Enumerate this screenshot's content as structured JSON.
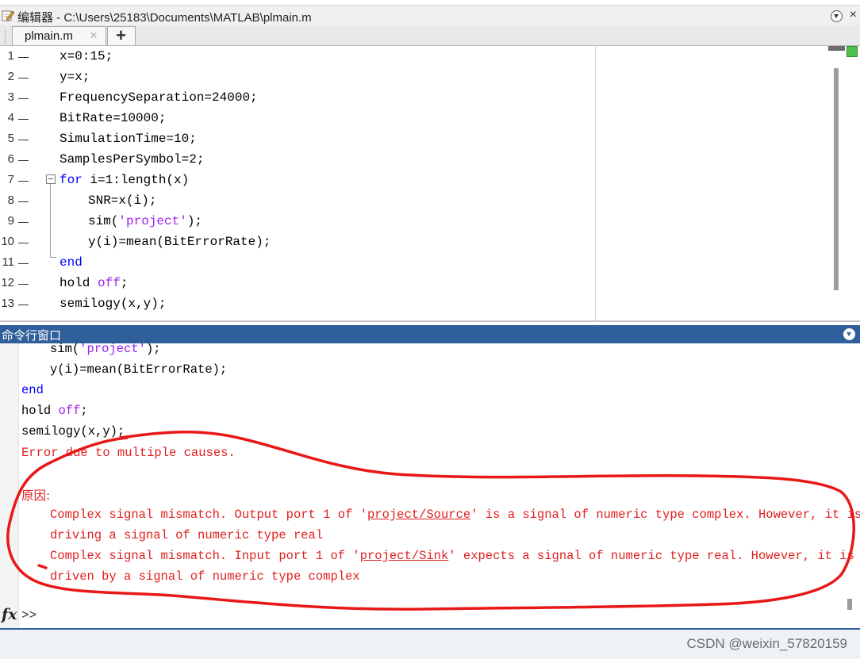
{
  "editor": {
    "title": "编辑器 - C:\\Users\\25183\\Documents\\MATLAB\\plmain.m",
    "tab_label": "plmain.m",
    "tab_close": "×",
    "tab_add": "+",
    "close_glyph": "×",
    "lines": [
      {
        "num": "1",
        "text": "x=0:15;"
      },
      {
        "num": "2",
        "text": "y=x;"
      },
      {
        "num": "3",
        "text": "FrequencySeparation=24000;"
      },
      {
        "num": "4",
        "text": "BitRate=10000;"
      },
      {
        "num": "5",
        "text": "SimulationTime=10;"
      },
      {
        "num": "6",
        "text": "SamplesPerSymbol=2;"
      },
      {
        "num": "7",
        "kw": "for",
        "text": " i=1:length(x)"
      },
      {
        "num": "8",
        "text": "SNR=x(i);"
      },
      {
        "num": "9",
        "pre": "sim(",
        "str": "'project'",
        "post": ");"
      },
      {
        "num": "10",
        "text": "y(i)=mean(BitErrorRate);"
      },
      {
        "num": "11",
        "kw": "end"
      },
      {
        "num": "12",
        "pre": "hold ",
        "str": "off",
        "post": ";"
      },
      {
        "num": "13",
        "text": "semilogy(x,y);"
      }
    ]
  },
  "command_window": {
    "title": "命令行窗口",
    "history": [
      {
        "pre": "sim(",
        "str": "'project'",
        "post": ");"
      },
      {
        "text": "y(i)=mean(BitErrorRate);"
      },
      {
        "kw": "end"
      },
      {
        "pre": "hold ",
        "str": "off",
        "post": ";"
      },
      {
        "text": "semilogy(x,y);"
      }
    ],
    "error_header": "Error due to multiple causes.",
    "cause_label": "原因:",
    "cause1_a": "Complex signal mismatch. Output port 1 of '",
    "cause1_link": "project/Source",
    "cause1_b": "' is a signal of numeric type complex. However, it is",
    "cause1_c": "driving a signal of numeric type real",
    "cause2_a": "Complex signal mismatch. Input port 1 of '",
    "cause2_link": "project/Sink",
    "cause2_b": "' expects a signal of numeric type real. However, it is",
    "cause2_c": "driven by a signal of numeric type complex",
    "prompt_fx": "fx",
    "prompt": ">>"
  },
  "watermark": "CSDN @weixin_57820159",
  "colors": {
    "keyword": "#0000ff",
    "string": "#a020f0",
    "error": "#e02020",
    "command_title_bg": "#2f5f9a",
    "annotation_loop": "#e81818"
  }
}
